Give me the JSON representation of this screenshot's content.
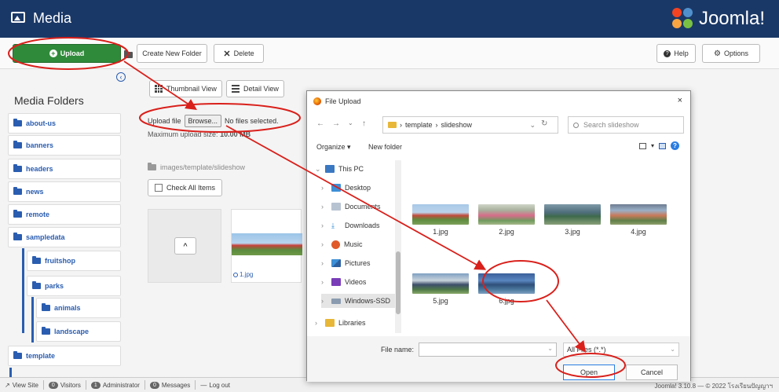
{
  "header": {
    "title": "Media",
    "brand": "Joomla!"
  },
  "toolbar": {
    "upload_label": "Upload",
    "create_folder_label": "Create New Folder",
    "delete_label": "Delete",
    "help_label": "Help",
    "options_label": "Options"
  },
  "sidebar": {
    "heading": "Media Folders",
    "folders": [
      "about-us",
      "banners",
      "headers",
      "news",
      "remote",
      "sampledata",
      "fruitshop",
      "parks",
      "animals",
      "landscape",
      "template"
    ]
  },
  "main": {
    "thumbnail_view": "Thumbnail View",
    "detail_view": "Detail View",
    "upload_file_label": "Upload file",
    "browse_label": "Browse...",
    "no_files": "No files selected.",
    "max_size_label": "Maximum upload size:",
    "max_size_value": "10.00 MB",
    "path": "images/template/slideshow",
    "check_all": "Check All Items",
    "up_glyph": "^",
    "tile_caption": "1.jpg"
  },
  "dialog": {
    "title": "File Upload",
    "close_glyph": "×",
    "breadcrumb": [
      "template",
      "slideshow"
    ],
    "search_placeholder": "Search slideshow",
    "organize": "Organize",
    "new_folder": "New folder",
    "help_glyph": "?",
    "nav_items": [
      "This PC",
      "Desktop",
      "Documents",
      "Downloads",
      "Music",
      "Pictures",
      "Videos",
      "Windows-SSD",
      "Libraries"
    ],
    "files": [
      "1.jpg",
      "2.jpg",
      "3.jpg",
      "4.jpg",
      "5.jpg",
      "6.jpg"
    ],
    "file_name_label": "File name:",
    "file_type": "All Files (*.*)",
    "open_label": "Open",
    "cancel_label": "Cancel"
  },
  "statusbar": {
    "view_site": "View Site",
    "visitors_count": "0",
    "visitors": "Visitors",
    "admins_count": "1",
    "administrator": "Administrator",
    "messages_count": "0",
    "messages": "Messages",
    "logout": "Log out",
    "version": "Joomla! 3.10.8 — © 2022 โรงเรียนปัญญาฯ"
  },
  "colors": {
    "annotation": "#d9201b",
    "header": "#1a3867",
    "upload_green": "#2f8a3a",
    "link_blue": "#2a5db0"
  }
}
